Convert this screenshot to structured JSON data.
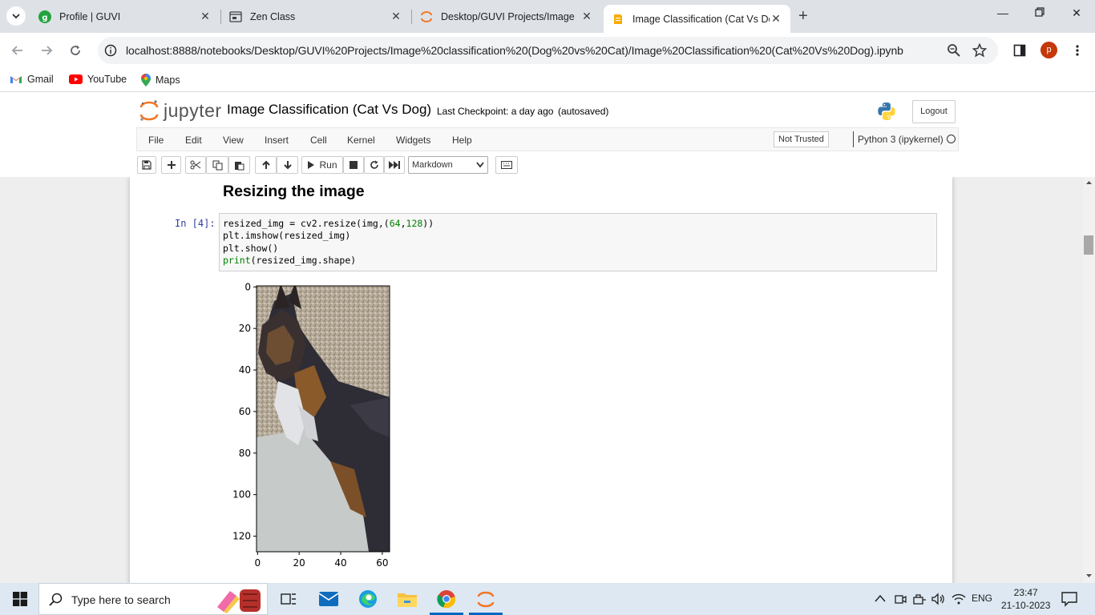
{
  "browser": {
    "tabs": [
      {
        "title": "Profile | GUVI",
        "icon": "guvi-icon"
      },
      {
        "title": "Zen Class",
        "icon": "window-icon"
      },
      {
        "title": "Desktop/GUVI Projects/Image",
        "icon": "jupyter-icon"
      },
      {
        "title": "Image Classification (Cat Vs Do",
        "icon": "notebook-icon",
        "active": true
      }
    ],
    "url": "localhost:8888/notebooks/Desktop/GUVI%20Projects/Image%20classification%20(Dog%20vs%20Cat)/Image%20Classification%20(Cat%20Vs%20Dog).ipynb",
    "profile_initial": "p",
    "bookmarks": [
      {
        "label": "Gmail",
        "icon": "gmail-icon"
      },
      {
        "label": "YouTube",
        "icon": "youtube-icon"
      },
      {
        "label": "Maps",
        "icon": "maps-icon"
      }
    ]
  },
  "jupyter": {
    "logo_text": "jupyter",
    "notebook_title": "Image Classification (Cat Vs Dog)",
    "checkpoint": "Last Checkpoint: a day ago",
    "autosaved": "(autosaved)",
    "logout": "Logout",
    "menu": [
      "File",
      "Edit",
      "View",
      "Insert",
      "Cell",
      "Kernel",
      "Widgets",
      "Help"
    ],
    "trust": "Not Trusted",
    "kernel": "Python 3 (ipykernel)",
    "run_label": "Run",
    "cell_type": "Markdown"
  },
  "notebook": {
    "heading": "Resizing the image",
    "prompt": "In [4]:",
    "code": [
      "resized_img = cv2.resize(img,(64,128))",
      "plt.imshow(resized_img)",
      "plt.show()",
      "print(resized_img.shape)"
    ]
  },
  "chart_data": {
    "type": "image",
    "x_ticks": [
      "0",
      "20",
      "40",
      "60"
    ],
    "y_ticks": [
      "0",
      "20",
      "40",
      "60",
      "80",
      "100",
      "120"
    ],
    "xlim": [
      -0.5,
      63.5
    ],
    "ylim": [
      127.5,
      -0.5
    ]
  },
  "taskbar": {
    "search_placeholder": "Type here to search",
    "language": "ENG",
    "time": "23:47",
    "date": "21-10-2023"
  }
}
